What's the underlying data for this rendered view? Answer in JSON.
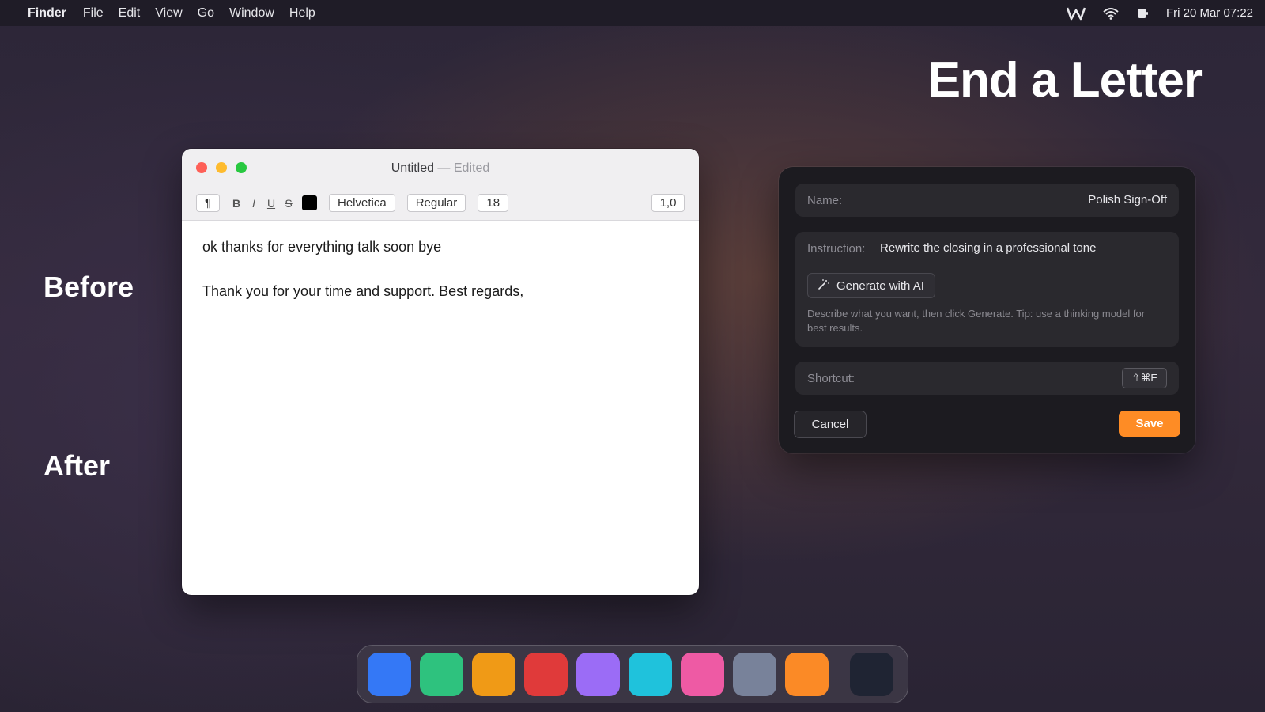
{
  "menubar": {
    "app_name": "Finder",
    "items": [
      "File",
      "Edit",
      "View",
      "Go",
      "Window",
      "Help"
    ],
    "clock": "Fri 20 Mar  07:22",
    "status_icons": [
      "app-w-icon",
      "wifi-icon",
      "battery-icon"
    ]
  },
  "headline": "End a Letter",
  "labels": {
    "before": "Before",
    "after": "After"
  },
  "editor": {
    "title": "Untitled",
    "title_separator": " — ",
    "title_status": "Edited",
    "toolbar": {
      "paragraph": "¶",
      "bold": "B",
      "italic": "I",
      "underline": "U",
      "strike": "S",
      "text_color": "#000000",
      "font_family": "Helvetica",
      "font_style": "Regular",
      "font_size": "18",
      "line_spacing": "1,0"
    },
    "lines": [
      "ok thanks for everything talk soon bye",
      "Thank you for your time and support. Best regards,"
    ]
  },
  "panel": {
    "name_label": "Name:",
    "name_value": "Polish Sign-Off",
    "instruction_label": "Instruction:",
    "instruction_value": "Rewrite the closing in a professional tone",
    "generate_label": "Generate with AI",
    "hint": "Describe what you want, then click Generate. Tip: use a thinking model for best results.",
    "shortcut_label": "Shortcut:",
    "shortcut_value": "⇧⌘E",
    "cancel_label": "Cancel",
    "save_label": "Save",
    "accent": "#fe8c25"
  },
  "dock": {
    "apps": [
      {
        "name": "app-blue",
        "color": "#3478f6"
      },
      {
        "name": "app-green",
        "color": "#2ec27e"
      },
      {
        "name": "app-amber",
        "color": "#f09a16"
      },
      {
        "name": "app-red",
        "color": "#e03a3a"
      },
      {
        "name": "app-purple",
        "color": "#9b6cf6"
      },
      {
        "name": "app-cyan",
        "color": "#1fc2dc"
      },
      {
        "name": "app-pink",
        "color": "#ee5aa4"
      },
      {
        "name": "app-gray",
        "color": "#78829a"
      },
      {
        "name": "app-orange",
        "color": "#fb8a26"
      }
    ],
    "trailing": {
      "name": "app-dark",
      "color": "#1f2433"
    }
  }
}
